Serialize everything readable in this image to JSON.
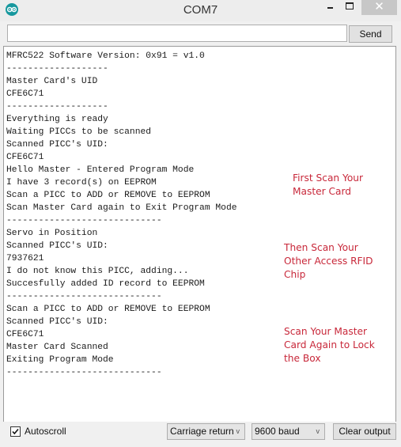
{
  "window": {
    "title": "COM7",
    "app_icon": "arduino-logo-icon",
    "controls": {
      "minimize_icon": "minimize-icon",
      "maximize_icon": "maximize-icon",
      "close_icon": "close-icon",
      "close_glyph": "✕"
    }
  },
  "input_row": {
    "input_value": "",
    "input_placeholder": "",
    "send_label": "Send"
  },
  "output": {
    "lines": [
      "MFRC522 Software Version: 0x91 = v1.0",
      "-------------------",
      "Master Card's UID",
      "CFE6C71",
      "-------------------",
      "Everything is ready",
      "Waiting PICCs to be scanned",
      "Scanned PICC's UID:",
      "CFE6C71",
      "Hello Master - Entered Program Mode",
      "I have 3 record(s) on EEPROM",
      "Scan a PICC to ADD or REMOVE to EEPROM",
      "Scan Master Card again to Exit Program Mode",
      "-----------------------------",
      "Servo in Position",
      "Scanned PICC's UID:",
      "7937621",
      "I do not know this PICC, adding...",
      "Succesfully added ID record to EEPROM",
      "-----------------------------",
      "Scan a PICC to ADD or REMOVE to EEPROM",
      "Scanned PICC's UID:",
      "CFE6C71",
      "Master Card Scanned",
      "Exiting Program Mode",
      "-----------------------------"
    ]
  },
  "annotations": {
    "color": "#c8283a",
    "notes": [
      {
        "lines": [
          "First Scan Your",
          "Master Card"
        ]
      },
      {
        "lines": [
          "Then Scan Your",
          "Other Access RFID",
          "Chip"
        ]
      },
      {
        "lines": [
          "Scan Your Master",
          "Card Again to Lock",
          "the Box"
        ]
      }
    ]
  },
  "bottom_bar": {
    "autoscroll_label": "Autoscroll",
    "autoscroll_checked": true,
    "line_ending_selected": "Carriage return",
    "baud_selected": "9600 baud",
    "dropdown_icon": "chevron-down-icon",
    "dropdown_glyph": "v",
    "clear_label": "Clear output"
  },
  "colors": {
    "app_icon_teal": "#17989e",
    "annotation_red": "#c8283a",
    "close_button_gray": "#c7c7c7"
  }
}
